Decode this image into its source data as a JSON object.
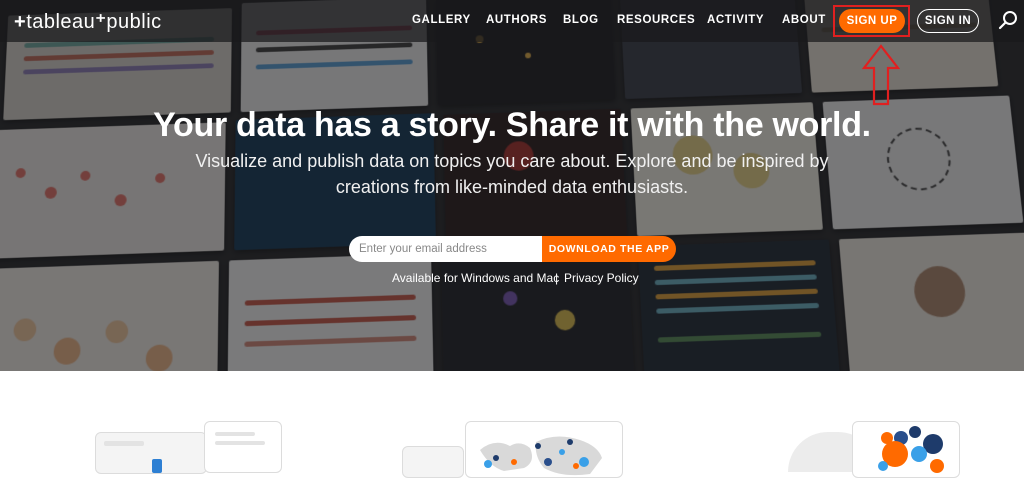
{
  "header": {
    "logo_text": "tableau",
    "logo_suffix": "public",
    "nav": [
      {
        "label": "GALLERY"
      },
      {
        "label": "AUTHORS"
      },
      {
        "label": "BLOG"
      },
      {
        "label": "RESOURCES"
      },
      {
        "label": "ACTIVITY"
      },
      {
        "label": "ABOUT"
      }
    ],
    "signup_label": "SIGN UP",
    "signin_label": "SIGN IN",
    "search_icon": "search-icon"
  },
  "hero": {
    "headline": "Your data has a story. Share it with the world.",
    "subline": "Visualize and publish data on topics you care about. Explore and be inspired by creations from like-minded data enthusiasts.",
    "email_placeholder": "Enter your email address",
    "download_label": "DOWNLOAD THE APP",
    "availability": "Available for Windows and Mac",
    "separator": "|",
    "privacy_link": "Privacy Policy"
  },
  "colors": {
    "accent": "#ff6a00",
    "annotation": "#e02020",
    "header_bg": "#19191c"
  }
}
